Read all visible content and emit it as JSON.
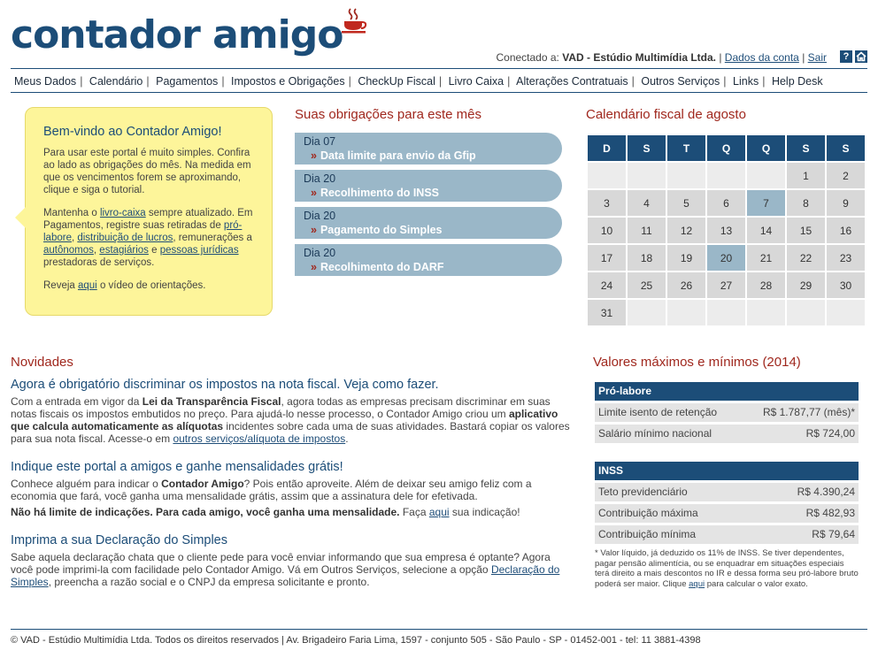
{
  "header": {
    "logo_text": "contador amigo",
    "connected_label": "Conectado a:",
    "company": "VAD - Estúdio Multimídia Ltda.",
    "account_link": "Dados da conta",
    "logout_link": "Sair",
    "help_icon_text": "?"
  },
  "nav": [
    "Meus Dados",
    "Calendário",
    "Pagamentos",
    "Impostos e Obrigações",
    "CheckUp Fiscal",
    "Livro Caixa",
    "Alterações Contratuais",
    "Outros Serviços",
    "Links",
    "Help Desk"
  ],
  "welcome": {
    "title": "Bem-vindo ao Contador Amigo!",
    "p1": "Para usar este portal é muito simples. Confira ao lado as obrigações do mês. Na medida em que os vencimentos forem se aproximando, clique e siga o tutorial.",
    "p2_a": "Mantenha o ",
    "p2_link1": "livro-caixa",
    "p2_b": " sempre atualizado. Em Pagamentos, registre suas retiradas de ",
    "p2_link2": "pró-labore",
    "p2_c": ", ",
    "p2_link3": "distribuição de lucros",
    "p2_d": ", remunerações a ",
    "p2_link4": "autônomos",
    "p2_e": ", ",
    "p2_link5": "estagiários",
    "p2_f": " e ",
    "p2_link6": "pessoas jurídicas",
    "p2_g": " prestadoras de serviços.",
    "p3_a": "Reveja ",
    "p3_link": "aqui",
    "p3_b": " o vídeo de orientações."
  },
  "obligations": {
    "title": "Suas obrigações para este mês",
    "items": [
      {
        "day": "Dia 07",
        "desc": "Data limite para envio da Gfip"
      },
      {
        "day": "Dia 20",
        "desc": "Recolhimento do INSS"
      },
      {
        "day": "Dia 20",
        "desc": "Pagamento do Simples"
      },
      {
        "day": "Dia 20",
        "desc": "Recolhimento do DARF"
      }
    ],
    "arrow": "»"
  },
  "calendar": {
    "title": "Calendário fiscal de agosto",
    "weekdays": [
      "D",
      "S",
      "T",
      "Q",
      "Q",
      "S",
      "S"
    ],
    "rows": [
      [
        "",
        "",
        "",
        "",
        "",
        "1",
        "2"
      ],
      [
        "3",
        "4",
        "5",
        "6",
        "7",
        "8",
        "9"
      ],
      [
        "10",
        "11",
        "12",
        "13",
        "14",
        "15",
        "16"
      ],
      [
        "17",
        "18",
        "19",
        "20",
        "21",
        "22",
        "23"
      ],
      [
        "24",
        "25",
        "26",
        "27",
        "28",
        "29",
        "30"
      ],
      [
        "31",
        "",
        "",
        "",
        "",
        "",
        ""
      ]
    ],
    "highlighted_days": [
      "7",
      "20"
    ]
  },
  "news": {
    "title": "Novidades",
    "n1_title": "Agora é obrigatório discriminar os impostos na nota fiscal. Veja como fazer.",
    "n1_a": "Com a entrada em vigor da ",
    "n1_b1": "Lei da Transparência Fiscal",
    "n1_c": ", agora todas as empresas precisam discriminar em suas notas fiscais os impostos embutidos no preço. Para ajudá-lo nesse processo, o Contador Amigo criou um ",
    "n1_b2": "aplicativo que calcula automaticamente as alíquotas",
    "n1_d": " incidentes sobre cada uma de suas atividades. Bastará copiar os valores para sua nota fiscal. Acesse-o em ",
    "n1_link": "outros serviços/alíquota de impostos",
    "n1_e": ".",
    "n2_title": "Indique este portal a amigos e ganhe mensalidades grátis!",
    "n2_a": "Conhece alguém para indicar o ",
    "n2_b1": "Contador Amigo",
    "n2_c": "? Pois então aproveite. Além de deixar seu amigo feliz com a economia que fará, você ganha uma mensalidade grátis, assim que a assinatura dele for efetivada.",
    "n2_b2": "Não há limite de indicações. Para cada amigo, você ganha uma mensalidade.",
    "n2_d": " Faça ",
    "n2_link": "aqui",
    "n2_e": " sua indicação!",
    "n3_title": "Imprima a sua Declaração do Simples",
    "n3_a": "Sabe aquela declaração chata que o cliente pede para você enviar informando que sua empresa é optante? Agora você pode imprimi-la com facilidade pelo Contador Amigo. Vá em Outros Serviços, selecione a opção ",
    "n3_link": "Declaração do Simples",
    "n3_b": ", preencha a razão social e o CNPJ da empresa solicitante e pronto."
  },
  "values": {
    "title": "Valores máximos e mínimos (2014)",
    "prolabore": {
      "header": "Pró-labore",
      "rows": [
        {
          "label": "Limite isento de retenção",
          "value": "R$ 1.787,77 (mês)*"
        },
        {
          "label": "Salário mínimo nacional",
          "value": "R$ 724,00"
        }
      ]
    },
    "inss": {
      "header": "INSS",
      "rows": [
        {
          "label": "Teto previdenciário",
          "value": "R$ 4.390,24"
        },
        {
          "label": "Contribuição máxima",
          "value": "R$ 482,93"
        },
        {
          "label": "Contribuição mínima",
          "value": "R$ 79,64"
        }
      ]
    },
    "note_a": "* Valor líquido, já deduzido os 11% de INSS. Se tiver dependentes, pagar pensão alimentícia, ou se enquadrar em situações especiais terá direito a mais descontos no IR e dessa forma seu pró-labore bruto poderá ser maior. Clique ",
    "note_link": "aqui",
    "note_b": " para calcular o valor exato."
  },
  "footer": {
    "text": "© VAD - Estúdio Multimídia Ltda. Todos os direitos reservados | Av. Brigadeiro Faria Lima, 1597 - conjunto 505 - São Paulo - SP - 01452-001 - tel: 11 3881-4398"
  },
  "colors": {
    "brand": "#1c4d78",
    "accent": "#a0281e",
    "note_bg": "#fdf59a",
    "obligation_bg": "#9ab7c8"
  }
}
